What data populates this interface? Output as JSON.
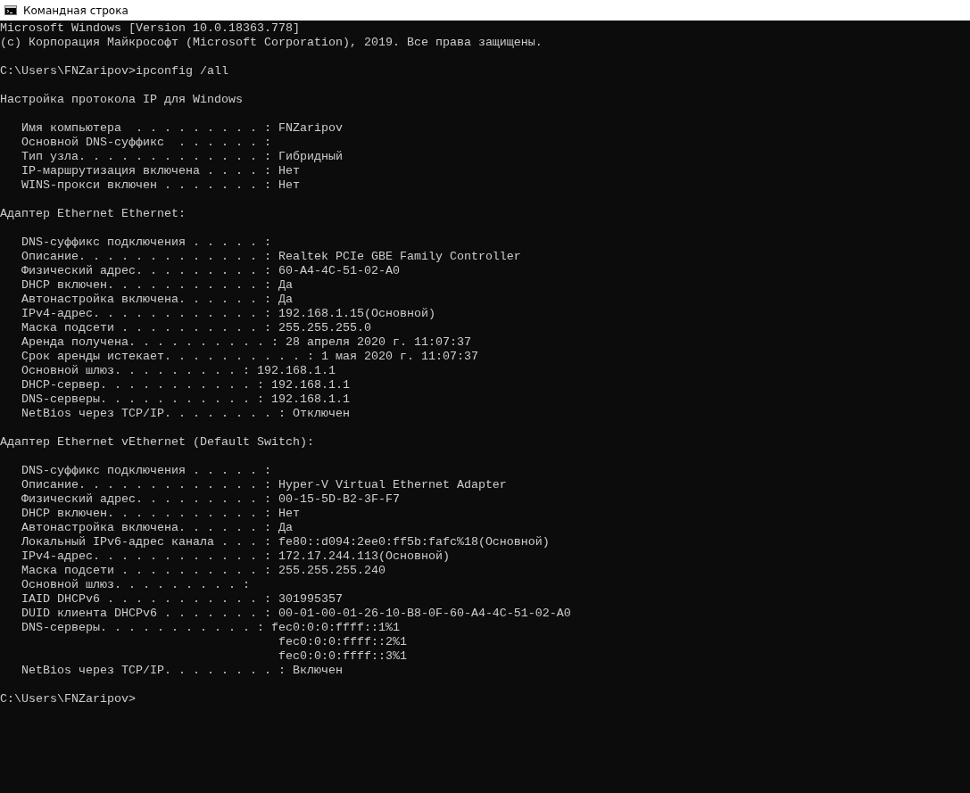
{
  "window": {
    "title": "Командная строка"
  },
  "console": {
    "blocks": [
      [
        "Microsoft Windows [Version 10.0.18363.778]",
        "(c) Корпорация Майкрософт (Microsoft Corporation), 2019. Все права защищены."
      ],
      [
        "C:\\Users\\FNZaripov>ipconfig /all"
      ],
      [
        "Настройка протокола IP для Windows"
      ],
      [
        "   Имя компьютера  . . . . . . . . . : FNZaripov",
        "   Основной DNS-суффикс  . . . . . . :",
        "   Тип узла. . . . . . . . . . . . . : Гибридный",
        "   IP-маршрутизация включена . . . . : Нет",
        "   WINS-прокси включен . . . . . . . : Нет"
      ],
      [
        "Адаптер Ethernet Ethernet:"
      ],
      [
        "   DNS-суффикс подключения . . . . . :",
        "   Описание. . . . . . . . . . . . . : Realtek PCIe GBE Family Controller",
        "   Физический адрес. . . . . . . . . : 60-A4-4C-51-02-A0",
        "   DHCP включен. . . . . . . . . . . : Да",
        "   Автонастройка включена. . . . . . : Да",
        "   IPv4-адрес. . . . . . . . . . . . : 192.168.1.15(Основной)",
        "   Маска подсети . . . . . . . . . . : 255.255.255.0",
        "   Аренда получена. . . . . . . . . . : 28 апреля 2020 г. 11:07:37",
        "   Срок аренды истекает. . . . . . . . . . : 1 мая 2020 г. 11:07:37",
        "   Основной шлюз. . . . . . . . . : 192.168.1.1",
        "   DHCP-сервер. . . . . . . . . . . : 192.168.1.1",
        "   DNS-серверы. . . . . . . . . . . : 192.168.1.1",
        "   NetBios через TCP/IP. . . . . . . . : Отключен"
      ],
      [
        "Адаптер Ethernet vEthernet (Default Switch):"
      ],
      [
        "   DNS-суффикс подключения . . . . . :",
        "   Описание. . . . . . . . . . . . . : Hyper-V Virtual Ethernet Adapter",
        "   Физический адрес. . . . . . . . . : 00-15-5D-B2-3F-F7",
        "   DHCP включен. . . . . . . . . . . : Нет",
        "   Автонастройка включена. . . . . . : Да",
        "   Локальный IPv6-адрес канала . . . : fe80::d094:2ee0:ff5b:fafc%18(Основной)",
        "   IPv4-адрес. . . . . . . . . . . . : 172.17.244.113(Основной)",
        "   Маска подсети . . . . . . . . . . : 255.255.255.240",
        "   Основной шлюз. . . . . . . . . :",
        "   IAID DHCPv6 . . . . . . . . . . . : 301995357",
        "   DUID клиента DHCPv6 . . . . . . . : 00-01-00-01-26-10-B8-0F-60-A4-4C-51-02-A0",
        "   DNS-серверы. . . . . . . . . . . : fec0:0:0:ffff::1%1",
        "                                       fec0:0:0:ffff::2%1",
        "                                       fec0:0:0:ffff::3%1",
        "   NetBios через TCP/IP. . . . . . . . : Включен"
      ],
      [
        "C:\\Users\\FNZaripov>"
      ]
    ]
  }
}
